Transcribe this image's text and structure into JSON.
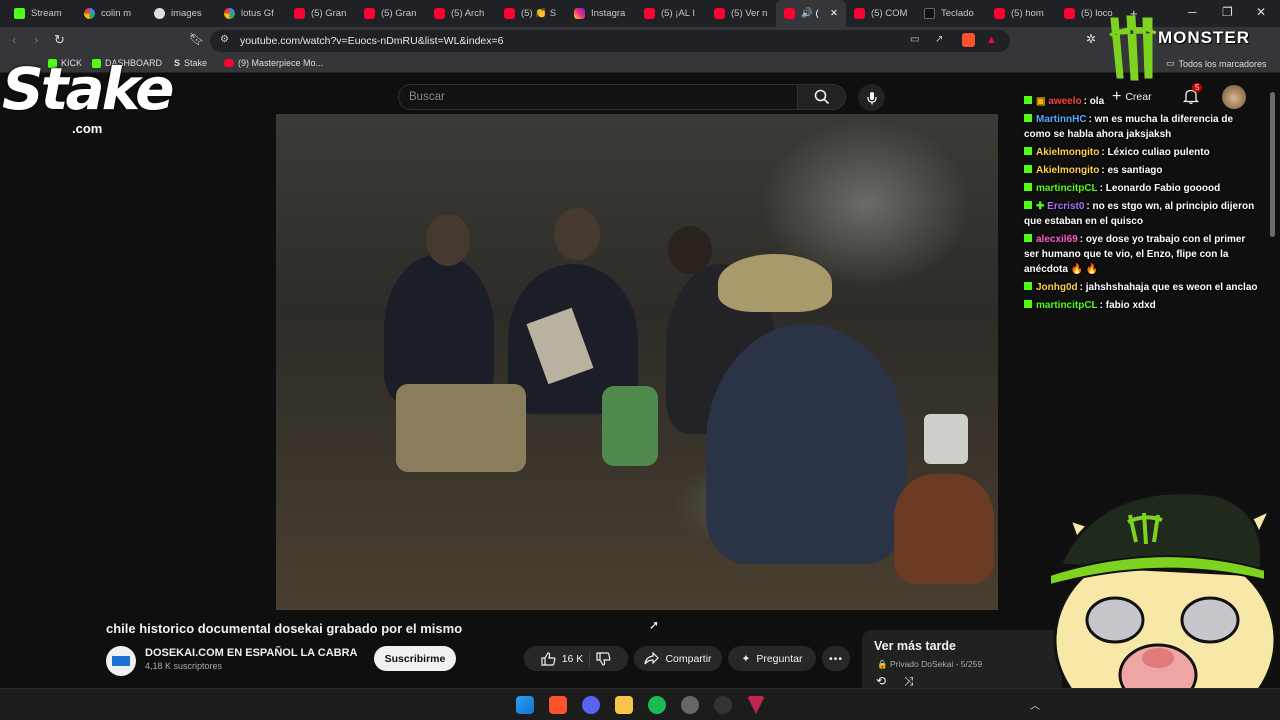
{
  "browser": {
    "tabs": [
      {
        "label": "Stream",
        "icon": "kick"
      },
      {
        "label": "colin m",
        "icon": "g"
      },
      {
        "label": "images",
        "icon": "gh"
      },
      {
        "label": "lotus Gf",
        "icon": "g"
      },
      {
        "label": "(5) Gran",
        "icon": "yt"
      },
      {
        "label": "(5) Gran",
        "icon": "yt"
      },
      {
        "label": "(5) Arch",
        "icon": "yt"
      },
      {
        "label": "(5) 👏 S",
        "icon": "yt"
      },
      {
        "label": "Instagra",
        "icon": "ig"
      },
      {
        "label": "(5) ¡AL I",
        "icon": "yt"
      },
      {
        "label": "(5) Ver n",
        "icon": "yt"
      },
      {
        "label": "🔊 (",
        "icon": "yt",
        "active": true
      },
      {
        "label": "(5) COM",
        "icon": "yt"
      },
      {
        "label": "Teclado",
        "icon": "tk"
      },
      {
        "label": "(5) hom",
        "icon": "yt"
      },
      {
        "label": "(5) loco",
        "icon": "yt"
      }
    ],
    "new_tab": "+",
    "url": "youtube.com/watch?v=Euocs-nDmRU&list=WL&index=6",
    "bookmarks": [
      {
        "label": "KICK"
      },
      {
        "label": "DASHBOARD"
      },
      {
        "label": "Stake"
      },
      {
        "label": "(9) Masterpiece Mo..."
      }
    ],
    "all_bookmarks": "Todos los marcadores"
  },
  "youtube": {
    "search_placeholder": "Buscar",
    "create_label": "Crear",
    "notification_count": "5",
    "video_title": "chile historico documental dosekai grabado por el mismo",
    "channel_name": "DOSEKAI.COM EN ESPAÑOL LA CABRA",
    "subscribers": "4,18 K suscriptores",
    "subscribe_label": "Suscribirme",
    "likes": "16 K",
    "share_label": "Compartir",
    "ask_label": "Preguntar",
    "playlist_title": "Ver más tarde",
    "playlist_meta": "🔒 Privado DoSekai - 5/259"
  },
  "chat": [
    {
      "user": "aweelo",
      "color": "#ff4444",
      "text": ": ola",
      "badge": "sub"
    },
    {
      "user": "MartinnHC",
      "color": "#5aa8ff",
      "text": ": wn es mucha la diferencia de como se habla ahora jaksjaksh"
    },
    {
      "user": "Akielmongito",
      "color": "#ffd24a",
      "text": ": Léxico culiao pulento"
    },
    {
      "user": "Akielmongito",
      "color": "#ffd24a",
      "text": ": es santiago"
    },
    {
      "user": "martincitpCL",
      "color": "#53fc18",
      "text": ": Leonardo Fabio gooood"
    },
    {
      "user": "Ercrist0",
      "color": "#a970ff",
      "text": ": no es stgo wn, al principio dijeron que estaban en el quisco",
      "badge": "gift"
    },
    {
      "user": "alecxil69",
      "color": "#ff5fd0",
      "text": ": oye dose yo trabajo con el primer ser humano que te vio, el Enzo, flipe con la anécdota 🔥 🔥"
    },
    {
      "user": "Jonhg0d",
      "color": "#ffd24a",
      "text": ": jahshshahaja que es weon el anclao"
    },
    {
      "user": "martincitpCL",
      "color": "#53fc18",
      "text": ": fabio xdxd"
    }
  ],
  "overlays": {
    "stake_word": "Stake",
    "stake_com": ".com",
    "monster_word": "MONSTER"
  },
  "colors": {
    "kick_green": "#53fc18",
    "youtube_red": "#ff0033",
    "monster_green": "#7ed321"
  }
}
